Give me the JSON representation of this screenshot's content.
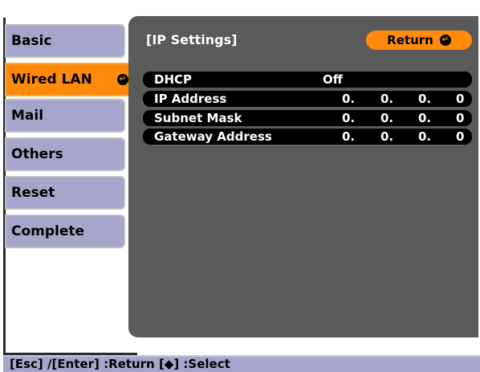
{
  "sidebar": {
    "items": [
      {
        "label": "Basic"
      },
      {
        "label": "Wired LAN"
      },
      {
        "label": "Mail"
      },
      {
        "label": "Others"
      },
      {
        "label": "Reset"
      },
      {
        "label": "Complete"
      }
    ],
    "selected": "Wired LAN"
  },
  "panel": {
    "title": "[IP Settings]",
    "return_label": "Return"
  },
  "settings": {
    "dhcp": {
      "label": "DHCP",
      "value": "Off"
    },
    "ip_address": {
      "label": "IP Address",
      "octets": [
        "0.",
        "0.",
        "0.",
        "0"
      ]
    },
    "subnet_mask": {
      "label": "Subnet Mask",
      "octets": [
        "0.",
        "0.",
        "0.",
        "0"
      ]
    },
    "gateway_address": {
      "label": "Gateway Address",
      "octets": [
        "0.",
        "0.",
        "0.",
        "0"
      ]
    }
  },
  "footer": {
    "text": "[Esc] /[Enter] :Return  [◆] :Select"
  },
  "icons": {
    "enter": "enter-icon"
  },
  "colors": {
    "accent": "#ff8a0b",
    "menu": "#a6a6cc",
    "panel": "#5a5a5a",
    "row": "#000000"
  }
}
